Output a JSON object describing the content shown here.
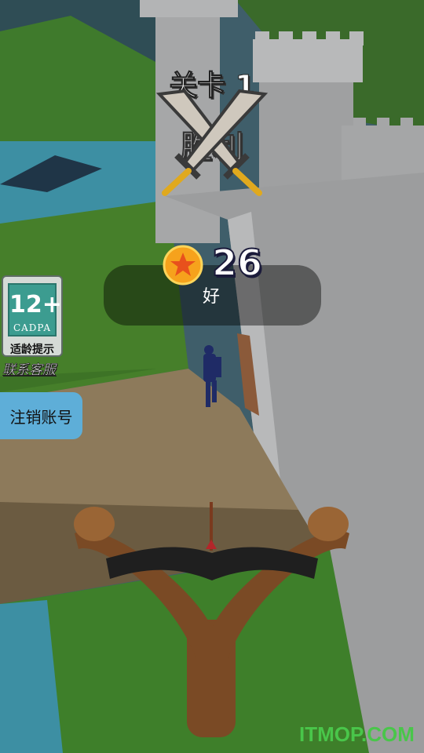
{
  "level": {
    "title": "关卡 1",
    "status_partial": "胜利"
  },
  "score": {
    "value": "26",
    "rating": "好"
  },
  "age_rating": {
    "age": "12+",
    "org": "CADPA",
    "label": "适龄提示"
  },
  "links": {
    "contact": "联系客服"
  },
  "buttons": {
    "logout": "注销账号"
  },
  "watermark": "ITMOP.COM",
  "icons": {
    "swords": "crossed-swords-icon",
    "coin": "star-coin-icon"
  },
  "colors": {
    "score_panel": "#00000066",
    "logout_button": "#5eaed8",
    "watermark": "#49c64a",
    "coin": "#f6a21c",
    "enemy": "#1f2b66"
  }
}
